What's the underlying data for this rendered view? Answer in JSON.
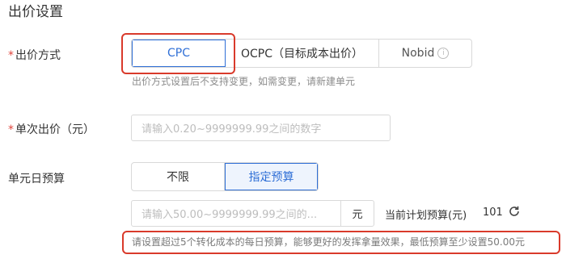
{
  "section": {
    "title": "出价设置"
  },
  "bid_method": {
    "label": "出价方式",
    "required_mark": "*",
    "options": [
      "CPC",
      "OCPC（目标成本出价）",
      "Nobid"
    ],
    "selected": "CPC",
    "hint": "出价方式设置后不支持变更，如需变更，请新建单元"
  },
  "single_bid": {
    "label": "单次出价（元）",
    "required_mark": "*",
    "placeholder": "请输入0.20~9999999.99之间的数字"
  },
  "daily_budget": {
    "label": "单元日预算",
    "options": [
      "不限",
      "指定预算"
    ],
    "selected": "指定预算",
    "placeholder": "请输入50.00~9999999.99之间的...",
    "unit": "元",
    "plan_budget_label": "当前计划预算(元)",
    "plan_budget_value": "101",
    "hint": "请设置超过5个转化成本的每日预算，能够更好的发挥拿量效果，最低预算至少设置50.00元"
  },
  "icons": {
    "info": "info-icon",
    "refresh": "refresh-icon"
  },
  "colors": {
    "accent": "#2f6fd6",
    "highlight_border": "#d93a2b",
    "required": "#e0453c"
  }
}
